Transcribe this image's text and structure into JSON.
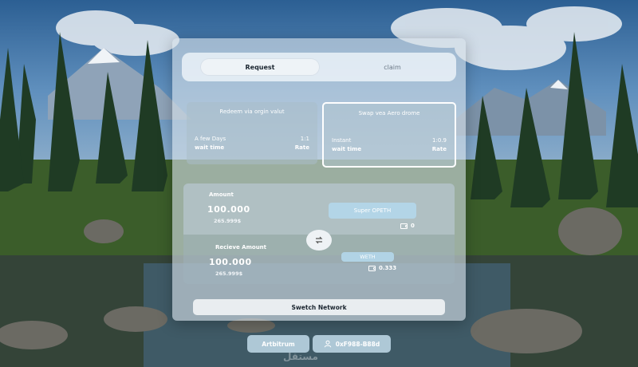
{
  "tabs": {
    "request": "Request",
    "claim": "claim"
  },
  "routes": [
    {
      "title": "Redeem via orgin  valut",
      "time_value": "A few Days",
      "time_label": "wait time",
      "rate_value": "1:1",
      "rate_label": "Rate"
    },
    {
      "title": "Swap vea Aero drome",
      "time_value": "Instant",
      "time_label": "wait time",
      "rate_value": "1:0.9",
      "rate_label": "Rate",
      "selected": true
    }
  ],
  "amount": {
    "label": "Amount",
    "value": "100.000",
    "usd": "265.999$",
    "token": "Super  OPETH",
    "balance": "0"
  },
  "receive": {
    "label": "Recieve Amount",
    "value": "100.000",
    "usd": "265.999$",
    "token": "WETH",
    "balance": "0.333"
  },
  "network_button": "Swetch Network",
  "chain_button": "Artbitrum",
  "wallet_button": "0xF988-B88d",
  "watermark": "مستقل",
  "icons": {
    "swap": "swap-arrows-icon",
    "wallet": "wallet-icon",
    "account": "user-icon"
  }
}
